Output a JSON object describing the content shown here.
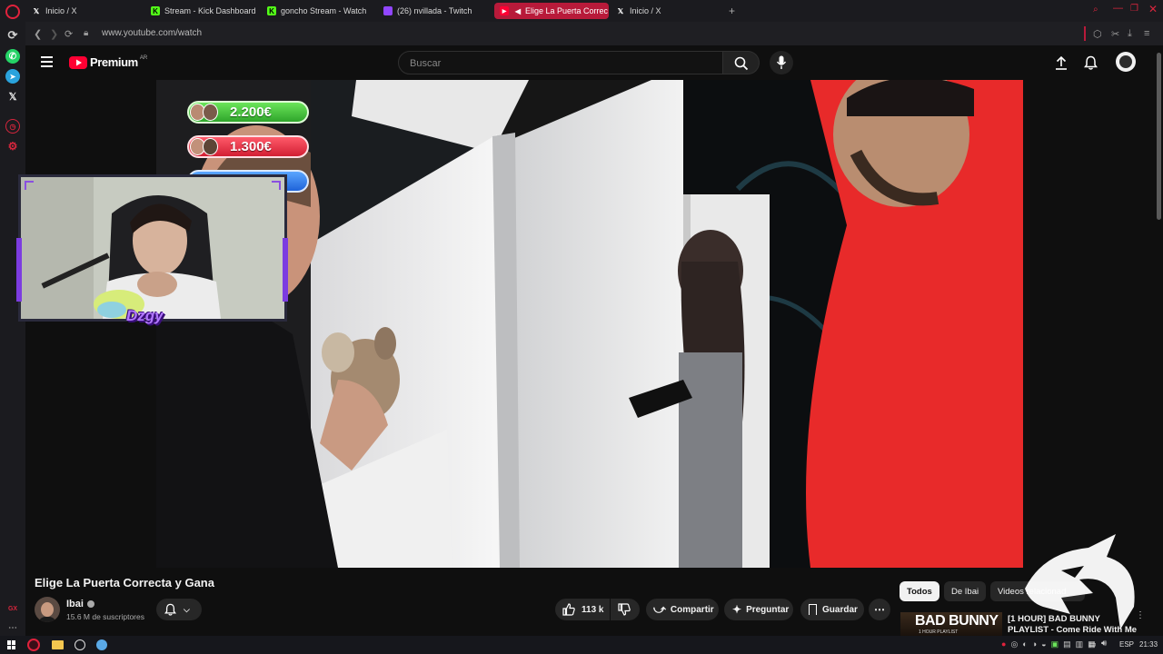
{
  "browser": {
    "tabs": [
      {
        "label": "Inicio / X",
        "icon": "x-logo-icon"
      },
      {
        "label": "Stream - Kick Dashboard",
        "icon": "kick-logo-icon"
      },
      {
        "label": "goncho Stream - Watch L",
        "icon": "kick-logo-icon"
      },
      {
        "label": "(26) nvillada - Twitch",
        "icon": "twitch-logo-icon"
      },
      {
        "label": "Elige La Puerta Correc",
        "icon": "youtube-logo-icon",
        "active": true
      },
      {
        "label": "Inicio / X",
        "icon": "x-logo-icon"
      }
    ],
    "url": "www.youtube.com/watch",
    "accent_color": "#b81a3a"
  },
  "youtube": {
    "logo_text": "Premium",
    "region_code": "AR",
    "search_placeholder": "Buscar"
  },
  "stream_overlay": {
    "scores": [
      "2.200€",
      "1.300€"
    ],
    "cam_tag": "Dzgy"
  },
  "video": {
    "title": "Elige La Puerta Correcta y Gana"
  },
  "channel": {
    "name": "Ibai",
    "subscribers": "15.6 M de suscriptores"
  },
  "actions": {
    "likes": "113 k",
    "share": "Compartir",
    "ask": "Preguntar",
    "save": "Guardar"
  },
  "chips": [
    "Todos",
    "De Ibai",
    "Videos relacionad"
  ],
  "recommendation": {
    "thumb_text": "BAD BUNNY",
    "thumb_sub": "1 HOUR PLAYLIST",
    "title_line1": "[1 HOUR] BAD BUNNY",
    "title_line2": "PLAYLIST - Come Ride With Me"
  },
  "taskbar": {
    "language": "ESP",
    "time": "21:33"
  }
}
